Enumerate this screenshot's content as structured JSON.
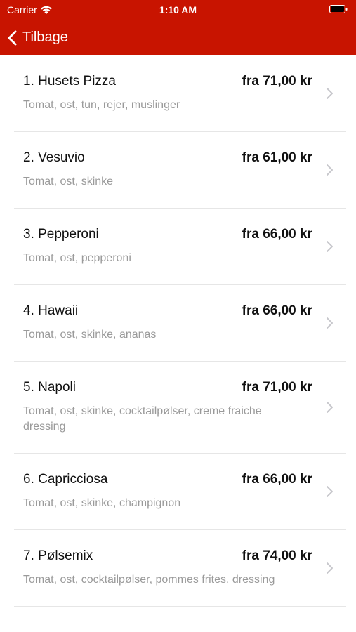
{
  "status_bar": {
    "carrier": "Carrier",
    "time": "1:10 AM"
  },
  "nav": {
    "back_label": "Tilbage"
  },
  "colors": {
    "header_bg": "#c81400",
    "description": "#9a9a9a",
    "chevron": "#c7c7cc"
  },
  "icons": {
    "wifi": "wifi-icon",
    "battery": "battery-icon",
    "back": "chevron-left-icon",
    "row": "chevron-right-icon"
  },
  "items": [
    {
      "name": "1. Husets Pizza",
      "price": "fra 71,00 kr",
      "desc": "Tomat, ost, tun, rejer, muslinger"
    },
    {
      "name": "2. Vesuvio",
      "price": "fra 61,00 kr",
      "desc": "Tomat, ost, skinke"
    },
    {
      "name": "3. Pepperoni",
      "price": "fra 66,00 kr",
      "desc": "Tomat, ost, pepperoni"
    },
    {
      "name": "4. Hawaii",
      "price": "fra 66,00 kr",
      "desc": "Tomat, ost, skinke, ananas"
    },
    {
      "name": "5. Napoli",
      "price": "fra 71,00 kr",
      "desc": "Tomat, ost, skinke, cocktailpølser, creme fraiche dressing"
    },
    {
      "name": "6. Capricciosa",
      "price": "fra 66,00 kr",
      "desc": "Tomat, ost, skinke, champignon"
    },
    {
      "name": "7. Pølsemix",
      "price": "fra 74,00 kr",
      "desc": "Tomat, ost, cocktailpølser, pommes frites, dressing"
    }
  ]
}
